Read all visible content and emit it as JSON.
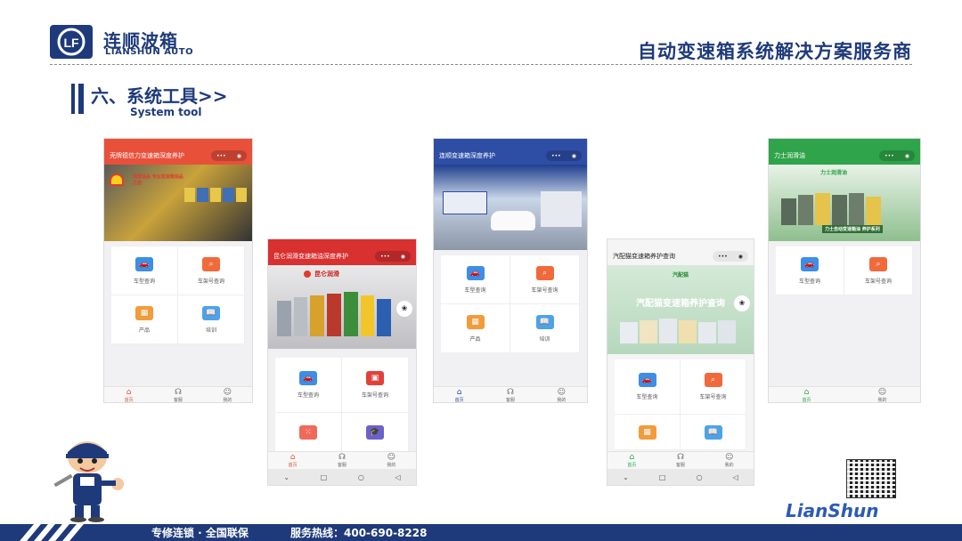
{
  "header": {
    "company_name": "连顺波箱",
    "company_sub": "LIANSHUN AUTO",
    "logo_letters": "LF",
    "slogan": "自动变速箱系统解决方案服务商"
  },
  "section": {
    "title": "六、系统工具>>",
    "subtitle": "System tool"
  },
  "phones": {
    "p1": {
      "title": "壳牌德信力变速箱深度养护",
      "banner_text": "润滑油品 专业变速箱油品之选",
      "grid": [
        "车型查询",
        "车架号查询",
        "产品",
        "培训"
      ],
      "tabs": [
        "首页",
        "客服",
        "我的"
      ]
    },
    "p2": {
      "title": "昆仑润滑变速箱油深度养护",
      "banner_text": "昆仑润滑",
      "grid": [
        "车型查询",
        "车架号查询",
        "",
        ""
      ],
      "tabs": [
        "首页",
        "客服",
        "我的"
      ],
      "nav": [
        "⌄",
        "□",
        "○",
        "◁"
      ]
    },
    "p3": {
      "title": "连顺变速箱深度养护",
      "grid": [
        "车型查询",
        "车架号查询",
        "产品",
        "培训"
      ],
      "tabs": [
        "首页",
        "客服",
        "我的"
      ]
    },
    "p4": {
      "title": "汽配猫变速箱养护查询",
      "banner_text": "汽配猫变速箱养护查询",
      "banner_logo": "汽配猫",
      "grid": [
        "车型查询",
        "车架号查询",
        "",
        ""
      ],
      "tabs": [
        "首页",
        "客服",
        "我的"
      ],
      "nav": [
        "⌄",
        "□",
        "○",
        "◁"
      ]
    },
    "p5": {
      "title": "力士润滑油",
      "banner_text": "力士自动变速箱油 养护系列",
      "banner_logo": "力士润滑油",
      "grid": [
        "车型查询",
        "车架号查询"
      ],
      "tabs": [
        "首页",
        "我的"
      ]
    }
  },
  "footer": {
    "left": "专修连锁 · 全国联保",
    "hotline": "服务热线：400-690-8228"
  },
  "brand": "LianShun",
  "colors": {
    "navy": "#1e3a7a",
    "shell_red": "#e8503a",
    "kunlun_red": "#d93030",
    "lianshun_blue": "#2e4ea6",
    "liushi_green": "#2fa44a",
    "white": "#f5f5f5"
  }
}
